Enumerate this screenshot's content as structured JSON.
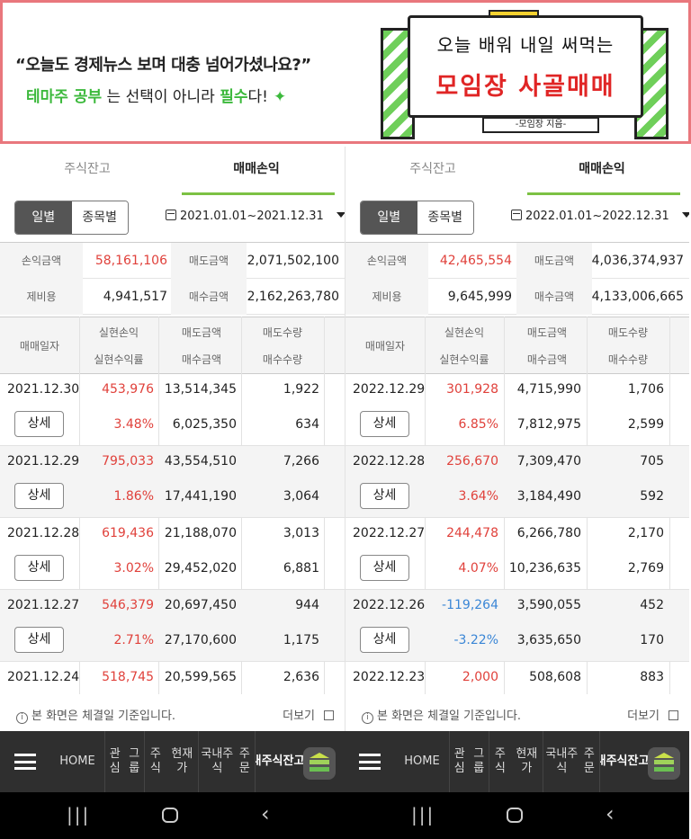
{
  "banner": {
    "question": "“오늘도 경제뉴스 보며 대충 넘어가셨나요?”",
    "theme_study": "테마주 공부",
    "line2_mid": "는 선택이 아니라",
    "must": "필수",
    "line2_end": "다!",
    "star": "✦",
    "board_line1": "오늘 배워 내일 써먹는",
    "board_title": "모임장 사골매매",
    "board_author": "-모임장 지음-"
  },
  "panels": [
    {
      "tabs": [
        "주식잔고",
        "매매손익"
      ],
      "segment": [
        "일별",
        "종목별"
      ],
      "date_range": "2021.01.01~2021.12.31",
      "summary": {
        "profit_label": "손익금액",
        "profit": "58,161,106",
        "sell_label": "매도금액",
        "sell": "2,071,502,100",
        "fee_label": "제비용",
        "fee": "4,941,517",
        "buy_label": "매수금액",
        "buy": "2,162,263,780"
      },
      "headers": {
        "date": "매매일자",
        "realized": "실현손익",
        "rate": "실현수익률",
        "sell_amt": "매도금액",
        "buy_amt": "매수금액",
        "sell_qty": "매도수량",
        "buy_qty": "매수수량"
      },
      "detail_label": "상세",
      "rows": [
        {
          "date": "2021.12.30",
          "realized": "453,976",
          "rate": "3.48%",
          "sell_amt": "13,514,345",
          "buy_amt": "6,025,350",
          "sell_qty": "1,922",
          "buy_qty": "634"
        },
        {
          "date": "2021.12.29",
          "realized": "795,033",
          "rate": "1.86%",
          "sell_amt": "43,554,510",
          "buy_amt": "17,441,190",
          "sell_qty": "7,266",
          "buy_qty": "3,064"
        },
        {
          "date": "2021.12.28",
          "realized": "619,436",
          "rate": "3.02%",
          "sell_amt": "21,188,070",
          "buy_amt": "29,452,020",
          "sell_qty": "3,013",
          "buy_qty": "6,881"
        },
        {
          "date": "2021.12.27",
          "realized": "546,379",
          "rate": "2.71%",
          "sell_amt": "20,697,450",
          "buy_amt": "27,170,600",
          "sell_qty": "944",
          "buy_qty": "1,175"
        }
      ],
      "last_row": {
        "date": "2021.12.24",
        "realized": "518,745",
        "sell_amt": "20,599,565",
        "sell_qty": "2,636"
      },
      "notice": "본 화면은 체결일 기준입니다.",
      "more": "더보기"
    },
    {
      "tabs": [
        "주식잔고",
        "매매손익"
      ],
      "segment": [
        "일별",
        "종목별"
      ],
      "date_range": "2022.01.01~2022.12.31",
      "summary": {
        "profit_label": "손익금액",
        "profit": "42,465,554",
        "sell_label": "매도금액",
        "sell": "4,036,374,937",
        "fee_label": "제비용",
        "fee": "9,645,999",
        "buy_label": "매수금액",
        "buy": "4,133,006,665"
      },
      "headers": {
        "date": "매매일자",
        "realized": "실현손익",
        "rate": "실현수익률",
        "sell_amt": "매도금액",
        "buy_amt": "매수금액",
        "sell_qty": "매도수량",
        "buy_qty": "매수수량"
      },
      "detail_label": "상세",
      "rows": [
        {
          "date": "2022.12.29",
          "realized": "301,928",
          "rate": "6.85%",
          "sell_amt": "4,715,990",
          "buy_amt": "7,812,975",
          "sell_qty": "1,706",
          "buy_qty": "2,599"
        },
        {
          "date": "2022.12.28",
          "realized": "256,670",
          "rate": "3.64%",
          "sell_amt": "7,309,470",
          "buy_amt": "3,184,490",
          "sell_qty": "705",
          "buy_qty": "592"
        },
        {
          "date": "2022.12.27",
          "realized": "244,478",
          "rate": "4.07%",
          "sell_amt": "6,266,780",
          "buy_amt": "10,236,635",
          "sell_qty": "2,170",
          "buy_qty": "2,769"
        },
        {
          "date": "2022.12.26",
          "realized": "-119,264",
          "rate": "-3.22%",
          "sell_amt": "3,590,055",
          "buy_amt": "3,635,650",
          "sell_qty": "452",
          "buy_qty": "170"
        }
      ],
      "last_row": {
        "date": "2022.12.23",
        "realized": "2,000",
        "sell_amt": "508,608",
        "sell_qty": "883"
      },
      "notice": "본 화면은 체결일 기준입니다.",
      "more": "더보기"
    }
  ],
  "nav": {
    "home": "HOME",
    "interest": [
      "관심",
      "그룹"
    ],
    "price": [
      "주식",
      "현재가"
    ],
    "order": [
      "국내주식",
      "주문"
    ],
    "balance": [
      "국내주식",
      "잔고손익"
    ]
  },
  "colors": {
    "profit_red": "#e0413b",
    "loss_blue": "#3a86d6",
    "accent_green": "#7cc143",
    "banner_border": "#e9777d"
  }
}
